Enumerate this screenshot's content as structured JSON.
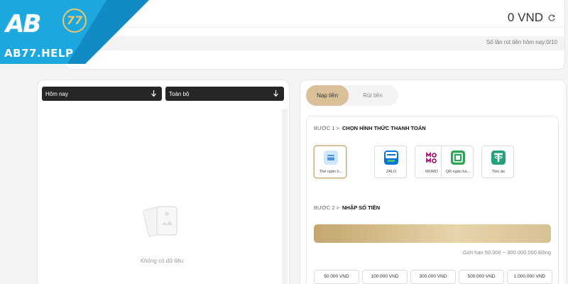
{
  "logo": {
    "brand_text": "AB",
    "number_text": "77",
    "help_text": "AB77.HELP"
  },
  "colors": {
    "brand_blue": "#1da7df",
    "gold_accent": "#d9c099",
    "dark": "#262626"
  },
  "balance": {
    "value": "0 VND",
    "refresh_icon": "refresh-icon",
    "withdraw_count": "Số lần rút tiền hôm nay:0/10"
  },
  "history": {
    "filters": [
      {
        "label": "Hôm nay",
        "icon": "arrow-down-icon"
      },
      {
        "label": "Toàn bộ",
        "icon": "arrow-down-icon"
      }
    ],
    "empty_text": "Không có dữ liệu",
    "empty_icon": "empty-cards-icon"
  },
  "transaction": {
    "tabs": [
      {
        "label": "Nạp tiền",
        "active": true
      },
      {
        "label": "Rút tiền",
        "active": false
      }
    ],
    "step1": {
      "num": "BƯỚC 1 >",
      "title": "CHỌN HÌNH THỨC THANH TOÁN"
    },
    "methods": [
      {
        "label": "Thẻ ngân h...",
        "icon": "bank-card-icon",
        "active": true
      },
      {
        "label": "ZALO",
        "icon": "zalopay-icon",
        "active": false
      },
      {
        "label": "MOMO",
        "icon": "momo-icon",
        "active": false
      },
      {
        "label": "QR ngân hà...",
        "icon": "qr-bank-icon",
        "active": false
      },
      {
        "label": "Tiền ảo",
        "icon": "tether-icon",
        "active": false
      }
    ],
    "step2": {
      "num": "BƯỚC 2 >",
      "title": "NHẬP SỐ TIỀN"
    },
    "amount_value": "",
    "limit_text": "Giới hạn 50.000 ~ 300.000.000 Đồng",
    "presets": [
      "50.000 VND",
      "100.000 VND",
      "300.000 VND",
      "500.000 VND",
      "1.000.000 VND"
    ]
  }
}
